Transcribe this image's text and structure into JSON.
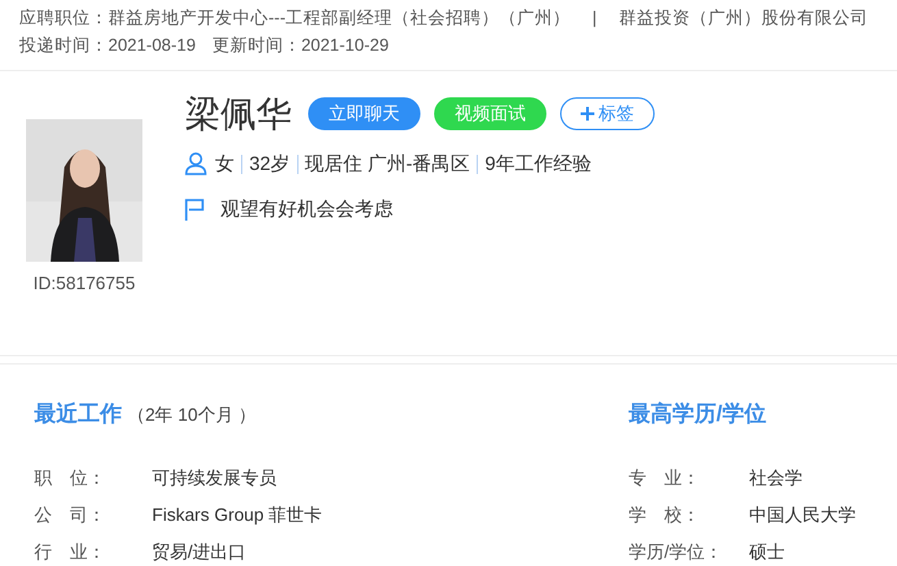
{
  "application": {
    "position_label": "应聘职位：",
    "position": "群益房地产开发中心---工程部副经理（社会招聘）（广州）",
    "separator": "|",
    "company": "群益投资（广州）股份有限公司",
    "applied_label": "投递时间：",
    "applied": "2021-08-19",
    "updated_label": "更新时间：",
    "updated": "2021-10-29"
  },
  "profile": {
    "name": "梁佩华",
    "id": "ID:58176755",
    "buttons": [
      {
        "label": "立即聊天",
        "kind": "primary"
      },
      {
        "label": "视频面试",
        "kind": "success"
      },
      {
        "label": "标签",
        "kind": "add"
      }
    ],
    "facts": [
      "女",
      "32岁",
      "现居住 广州-番禺区",
      "9年工作经验"
    ],
    "status": "观望有好机会会考虑"
  },
  "recent_work": {
    "title": "最近工作",
    "duration": "（2年 10个月 ）",
    "rows": [
      {
        "label": "职　位：",
        "value": "可持续发展专员"
      },
      {
        "label": "公　司：",
        "value": "Fiskars Group 菲世卡"
      },
      {
        "label": "行　业：",
        "value": "贸易/进出口"
      }
    ]
  },
  "education": {
    "title": "最高学历/学位",
    "rows": [
      {
        "label": "专　业：",
        "value": "社会学"
      },
      {
        "label": "学　校：",
        "value": "中国人民大学"
      },
      {
        "label": "学历/学位：",
        "value": "硕士"
      }
    ]
  }
}
